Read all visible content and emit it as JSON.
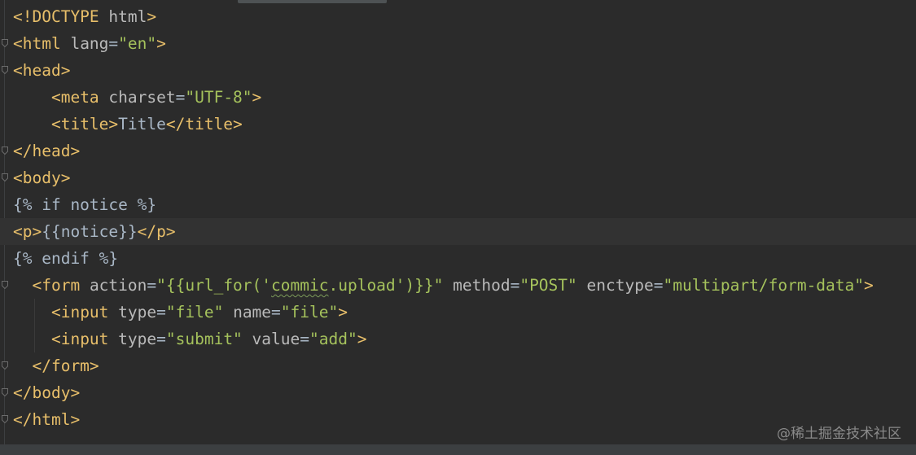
{
  "editor": {
    "lines": [
      {
        "tokens": [
          {
            "c": "tag",
            "t": "<!DOCTYPE "
          },
          {
            "c": "attr",
            "t": "html"
          },
          {
            "c": "tag",
            "t": ">"
          }
        ]
      },
      {
        "tokens": [
          {
            "c": "tag",
            "t": "<html "
          },
          {
            "c": "attr",
            "t": "lang"
          },
          {
            "c": "txt",
            "t": "="
          },
          {
            "c": "val",
            "t": "\"en\""
          },
          {
            "c": "tag",
            "t": ">"
          }
        ]
      },
      {
        "tokens": [
          {
            "c": "tag",
            "t": "<head>"
          }
        ]
      },
      {
        "tokens": [
          {
            "c": "txt",
            "t": "    "
          },
          {
            "c": "tag",
            "t": "<meta "
          },
          {
            "c": "attr",
            "t": "charset"
          },
          {
            "c": "txt",
            "t": "="
          },
          {
            "c": "val",
            "t": "\"UTF-8\""
          },
          {
            "c": "tag",
            "t": ">"
          }
        ]
      },
      {
        "tokens": [
          {
            "c": "txt",
            "t": "    "
          },
          {
            "c": "tag",
            "t": "<title>"
          },
          {
            "c": "txt",
            "t": "Title"
          },
          {
            "c": "tag",
            "t": "</title>"
          }
        ]
      },
      {
        "tokens": [
          {
            "c": "tag",
            "t": "</head>"
          }
        ]
      },
      {
        "tokens": [
          {
            "c": "tag",
            "t": "<body>"
          }
        ]
      },
      {
        "tokens": [
          {
            "c": "tpl",
            "t": "{% if notice %}"
          }
        ]
      },
      {
        "tokens": [
          {
            "c": "tag",
            "t": "<p>"
          },
          {
            "c": "tpl",
            "t": "{{notice}}"
          },
          {
            "c": "tag",
            "t": "</p>"
          }
        ]
      },
      {
        "tokens": [
          {
            "c": "tpl",
            "t": "{% endif %}"
          }
        ]
      },
      {
        "tokens": [
          {
            "c": "txt",
            "t": "  "
          },
          {
            "c": "tag",
            "t": "<form "
          },
          {
            "c": "attr",
            "t": "action"
          },
          {
            "c": "txt",
            "t": "="
          },
          {
            "c": "val",
            "t": "\"{{url_for('"
          },
          {
            "c": "val squig",
            "t": "commic"
          },
          {
            "c": "val",
            "t": ".upload')}}\""
          },
          {
            "c": "txt",
            "t": " "
          },
          {
            "c": "attr",
            "t": "method"
          },
          {
            "c": "txt",
            "t": "="
          },
          {
            "c": "val",
            "t": "\"POST\""
          },
          {
            "c": "txt",
            "t": " "
          },
          {
            "c": "attr",
            "t": "enctype"
          },
          {
            "c": "txt",
            "t": "="
          },
          {
            "c": "val",
            "t": "\"multipart/form-data\""
          },
          {
            "c": "tag",
            "t": ">"
          }
        ]
      },
      {
        "tokens": [
          {
            "c": "txt",
            "t": "    "
          },
          {
            "c": "tag",
            "t": "<input "
          },
          {
            "c": "attr",
            "t": "type"
          },
          {
            "c": "txt",
            "t": "="
          },
          {
            "c": "val",
            "t": "\"file\""
          },
          {
            "c": "txt",
            "t": " "
          },
          {
            "c": "attr",
            "t": "name"
          },
          {
            "c": "txt",
            "t": "="
          },
          {
            "c": "val",
            "t": "\"file\""
          },
          {
            "c": "tag",
            "t": ">"
          }
        ]
      },
      {
        "tokens": [
          {
            "c": "txt",
            "t": "    "
          },
          {
            "c": "tag",
            "t": "<input "
          },
          {
            "c": "attr",
            "t": "type"
          },
          {
            "c": "txt",
            "t": "="
          },
          {
            "c": "val",
            "t": "\"submit\""
          },
          {
            "c": "txt",
            "t": " "
          },
          {
            "c": "attr",
            "t": "value"
          },
          {
            "c": "txt",
            "t": "="
          },
          {
            "c": "val",
            "t": "\"add\""
          },
          {
            "c": "tag",
            "t": ">"
          }
        ]
      },
      {
        "tokens": [
          {
            "c": "txt",
            "t": "  "
          },
          {
            "c": "tag",
            "t": "</form>"
          }
        ]
      },
      {
        "tokens": [
          {
            "c": "tag",
            "t": "</body>"
          }
        ]
      },
      {
        "tokens": [
          {
            "c": "tag",
            "t": "</html>"
          }
        ]
      }
    ],
    "current_line_index": 8,
    "fold_marker_lines": [
      1,
      2,
      5,
      6,
      10,
      13,
      14,
      15
    ]
  },
  "watermark": {
    "text": "@稀土掘金技术社区"
  },
  "colors": {
    "background": "#2b2b2b",
    "tag": "#e8bf6a",
    "attribute": "#bababa",
    "string": "#a5c25c",
    "text": "#a9b7c6",
    "current_line": "#323232"
  }
}
